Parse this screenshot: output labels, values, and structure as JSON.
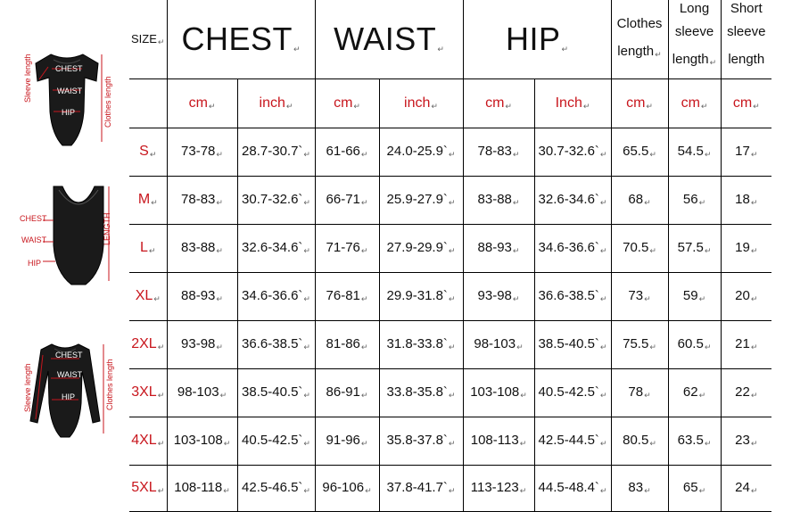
{
  "figures": {
    "short_sleeve": {
      "sleeve_label": "Sleeve length",
      "clothes_label": "Clothes length",
      "chest_label": "CHEST",
      "waist_label": "WAIST",
      "hip_label": "HIP"
    },
    "sleeveless": {
      "chest_label": "CHEST",
      "waist_label": "WAIST",
      "hip_label": "HIP",
      "length_label": "LENGTH"
    },
    "long_sleeve": {
      "sleeve_label": "Sleeve length",
      "clothes_label": "Clothes length",
      "chest_label": "CHEST",
      "waist_label": "WAIST",
      "hip_label": "HIP"
    }
  },
  "table": {
    "size_header": "SIZE",
    "chest_header": "CHEST",
    "waist_header": "WAIST",
    "hip_header": "HIP",
    "clothes_length_header_1": "Clothes",
    "clothes_length_header_2": "length",
    "long_sleeve_header_1": "Long",
    "long_sleeve_header_2": "sleeve",
    "long_sleeve_header_3": "length",
    "short_sleeve_header_1": "Short",
    "short_sleeve_header_2": "sleeve",
    "short_sleeve_header_3": "length",
    "units": [
      "cm",
      "inch",
      "cm",
      "inch",
      "cm",
      "Inch",
      "cm",
      "cm",
      "cm"
    ],
    "rows": [
      {
        "size": "S",
        "cells": [
          "73-78",
          "28.7-30.7`",
          "61-66",
          "24.0-25.9`",
          "78-83",
          "30.7-32.6`",
          "65.5",
          "54.5",
          "17"
        ]
      },
      {
        "size": "M",
        "cells": [
          "78-83",
          "30.7-32.6`",
          "66-71",
          "25.9-27.9`",
          "83-88",
          "32.6-34.6`",
          "68",
          "56",
          "18"
        ]
      },
      {
        "size": "L",
        "cells": [
          "83-88",
          "32.6-34.6`",
          "71-76",
          "27.9-29.9`",
          "88-93",
          "34.6-36.6`",
          "70.5",
          "57.5",
          "19"
        ]
      },
      {
        "size": "XL",
        "cells": [
          "88-93",
          "34.6-36.6`",
          "76-81",
          "29.9-31.8`",
          "93-98",
          "36.6-38.5`",
          "73",
          "59",
          "20"
        ]
      },
      {
        "size": "2XL",
        "cells": [
          "93-98",
          "36.6-38.5`",
          "81-86",
          "31.8-33.8`",
          "98-103",
          "38.5-40.5`",
          "75.5",
          "60.5",
          "21"
        ]
      },
      {
        "size": "3XL",
        "cells": [
          "98-103",
          "38.5-40.5`",
          "86-91",
          "33.8-35.8`",
          "103-108",
          "40.5-42.5`",
          "78",
          "62",
          "22"
        ]
      },
      {
        "size": "4XL",
        "cells": [
          "103-108",
          "40.5-42.5`",
          "91-96",
          "35.8-37.8`",
          "108-113",
          "42.5-44.5`",
          "80.5",
          "63.5",
          "23"
        ]
      },
      {
        "size": "5XL",
        "cells": [
          "108-118",
          "42.5-46.5`",
          "96-106",
          "37.8-41.7`",
          "113-123",
          "44.5-48.4`",
          "83",
          "65",
          "24"
        ]
      }
    ]
  }
}
